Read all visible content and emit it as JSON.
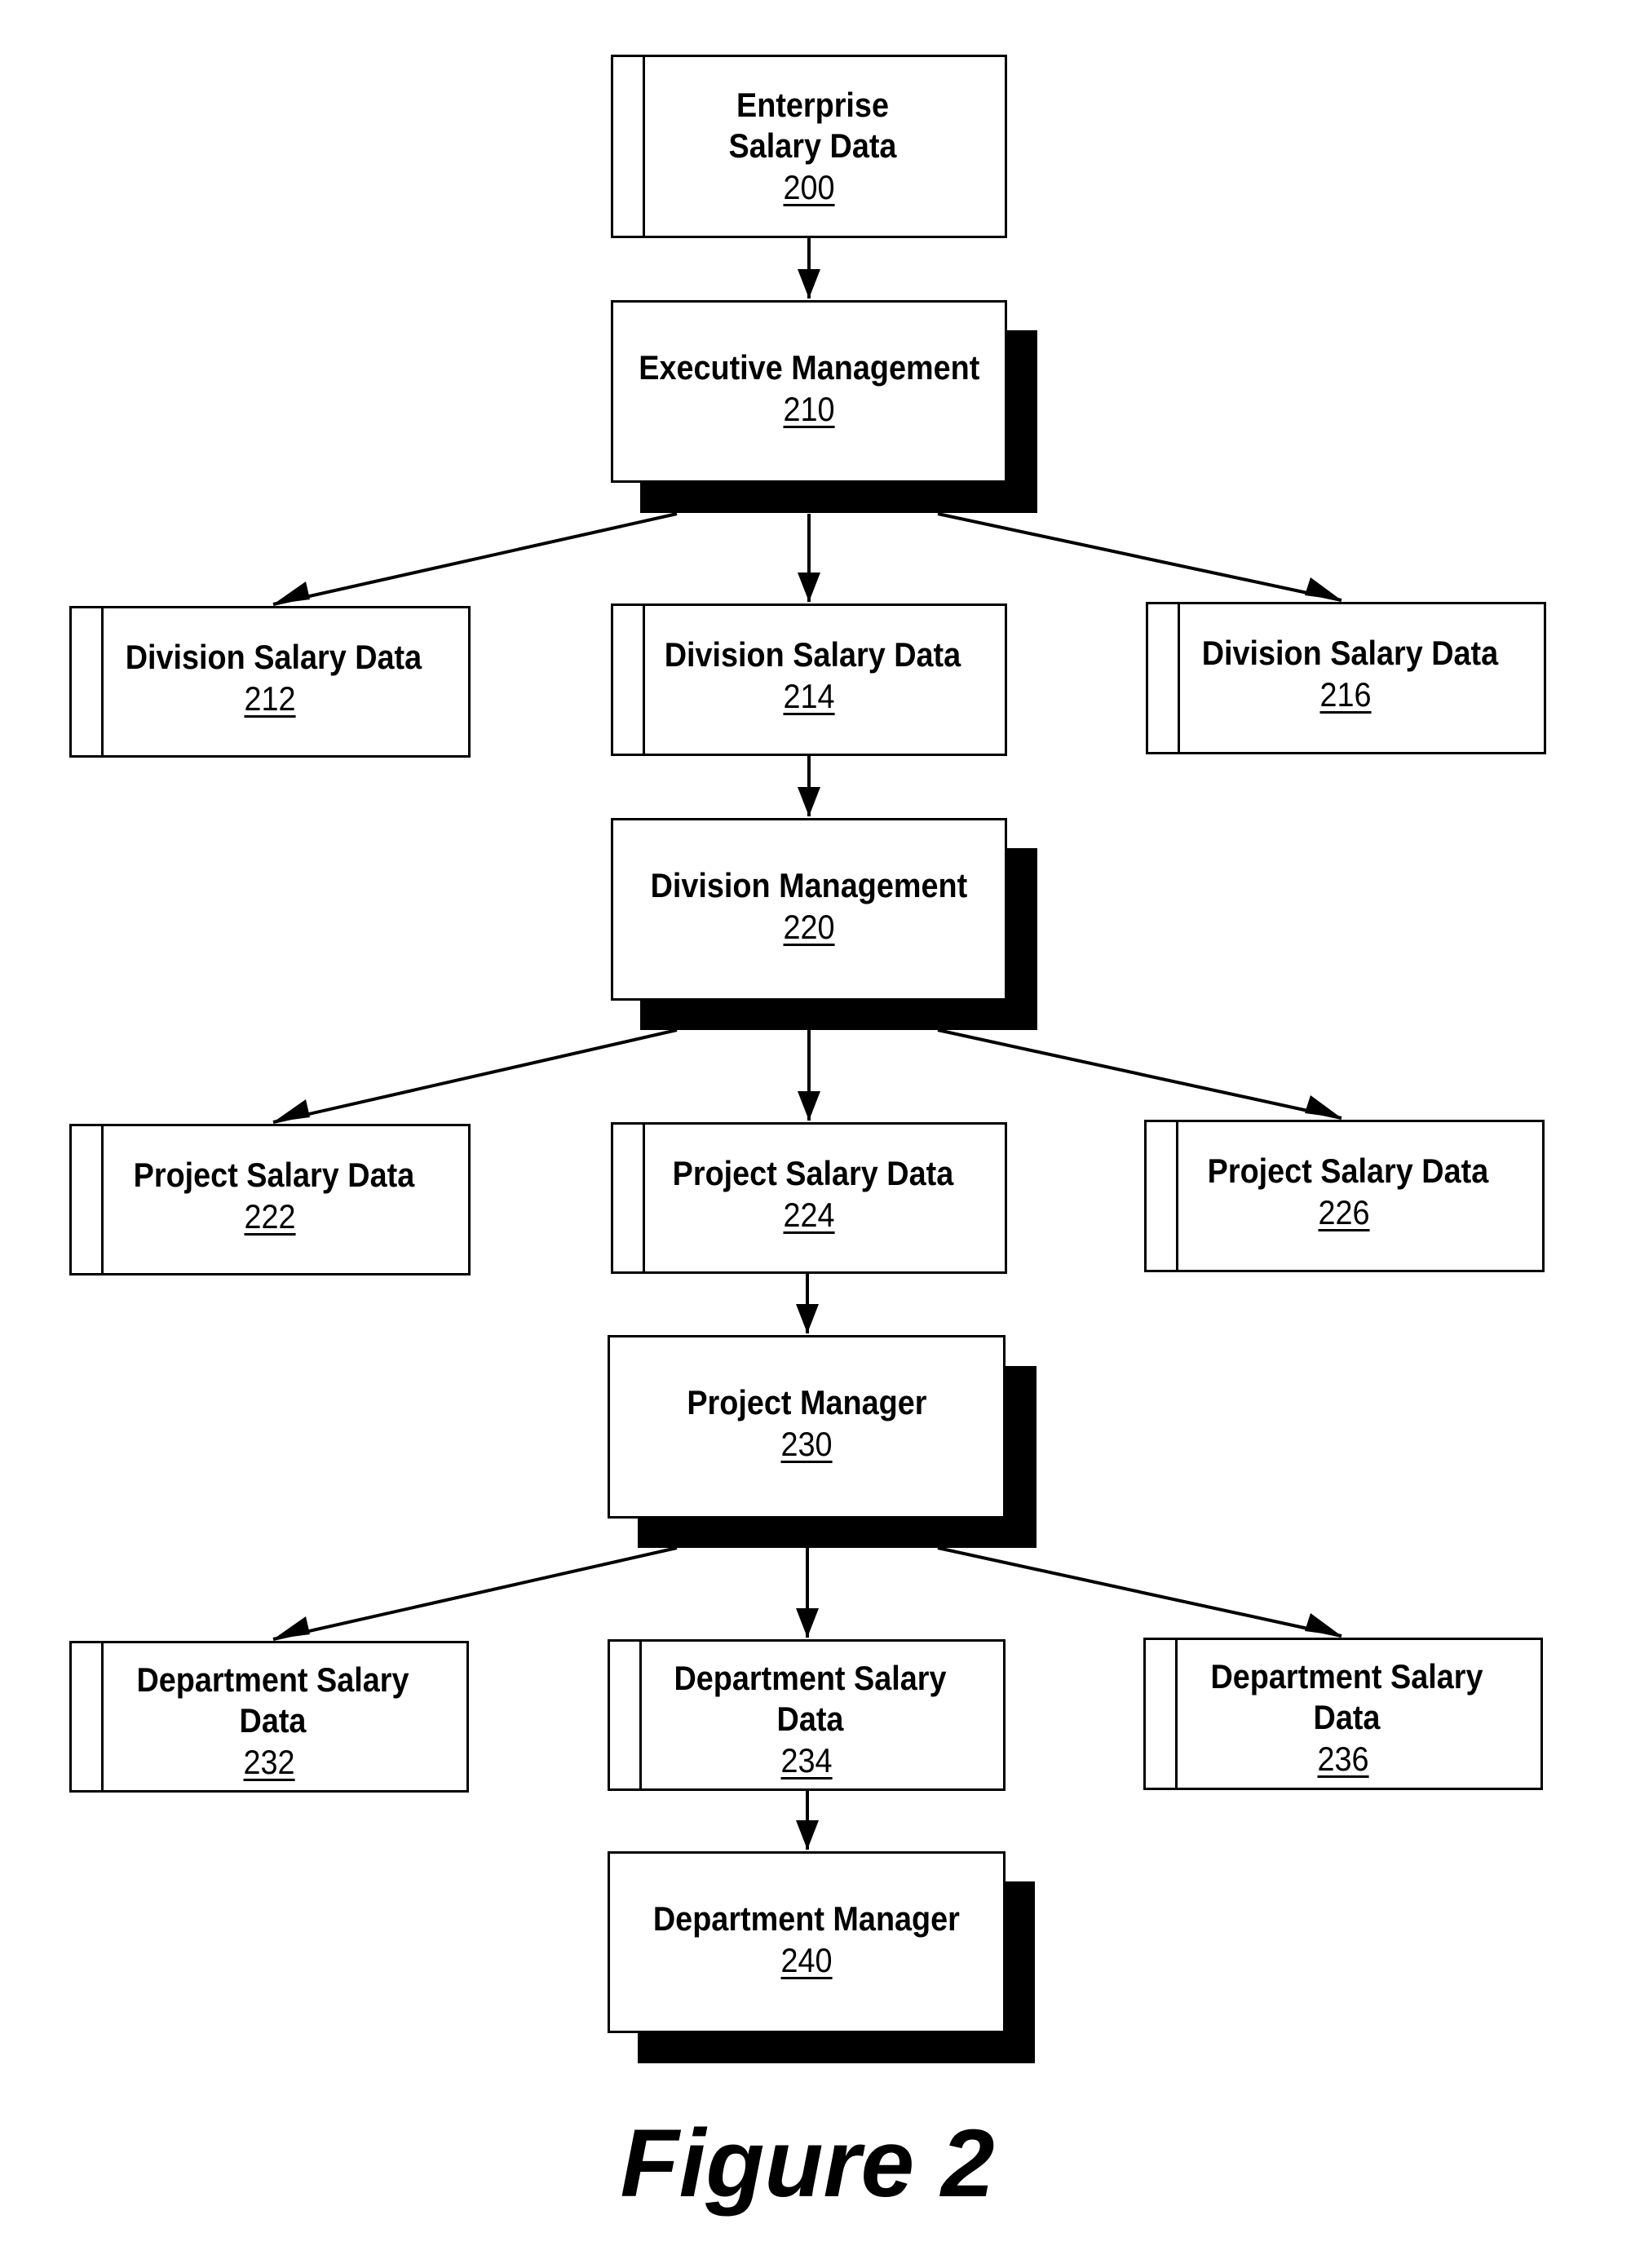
{
  "figure_label": "Figure 2",
  "nodes": {
    "n200": {
      "title": "Enterprise  Salary Data",
      "ref": "200",
      "kind": "data"
    },
    "n210": {
      "title": "Executive Management",
      "ref": "210",
      "kind": "management"
    },
    "n212": {
      "title": "Division Salary Data",
      "ref": "212",
      "kind": "data"
    },
    "n214": {
      "title": "Division Salary Data",
      "ref": "214",
      "kind": "data"
    },
    "n216": {
      "title": "Division Salary Data",
      "ref": "216",
      "kind": "data"
    },
    "n220": {
      "title": "Division Management",
      "ref": "220",
      "kind": "management"
    },
    "n222": {
      "title": "Project Salary Data",
      "ref": "222",
      "kind": "data"
    },
    "n224": {
      "title": "Project Salary Data",
      "ref": "224",
      "kind": "data"
    },
    "n226": {
      "title": "Project Salary Data",
      "ref": "226",
      "kind": "data"
    },
    "n230": {
      "title": "Project Manager",
      "ref": "230",
      "kind": "management"
    },
    "n232": {
      "title": "Department Salary Data",
      "ref": "232",
      "kind": "data"
    },
    "n234": {
      "title": "Department Salary Data",
      "ref": "234",
      "kind": "data"
    },
    "n236": {
      "title": "Department Salary Data",
      "ref": "236",
      "kind": "data"
    },
    "n240": {
      "title": "Department Manager",
      "ref": "240",
      "kind": "management"
    }
  },
  "edges": [
    {
      "from": "200",
      "to": "210"
    },
    {
      "from": "210",
      "to": "212"
    },
    {
      "from": "210",
      "to": "214"
    },
    {
      "from": "210",
      "to": "216"
    },
    {
      "from": "214",
      "to": "220"
    },
    {
      "from": "220",
      "to": "222"
    },
    {
      "from": "220",
      "to": "224"
    },
    {
      "from": "220",
      "to": "226"
    },
    {
      "from": "224",
      "to": "230"
    },
    {
      "from": "230",
      "to": "232"
    },
    {
      "from": "230",
      "to": "234"
    },
    {
      "from": "230",
      "to": "236"
    },
    {
      "from": "234",
      "to": "240"
    }
  ]
}
